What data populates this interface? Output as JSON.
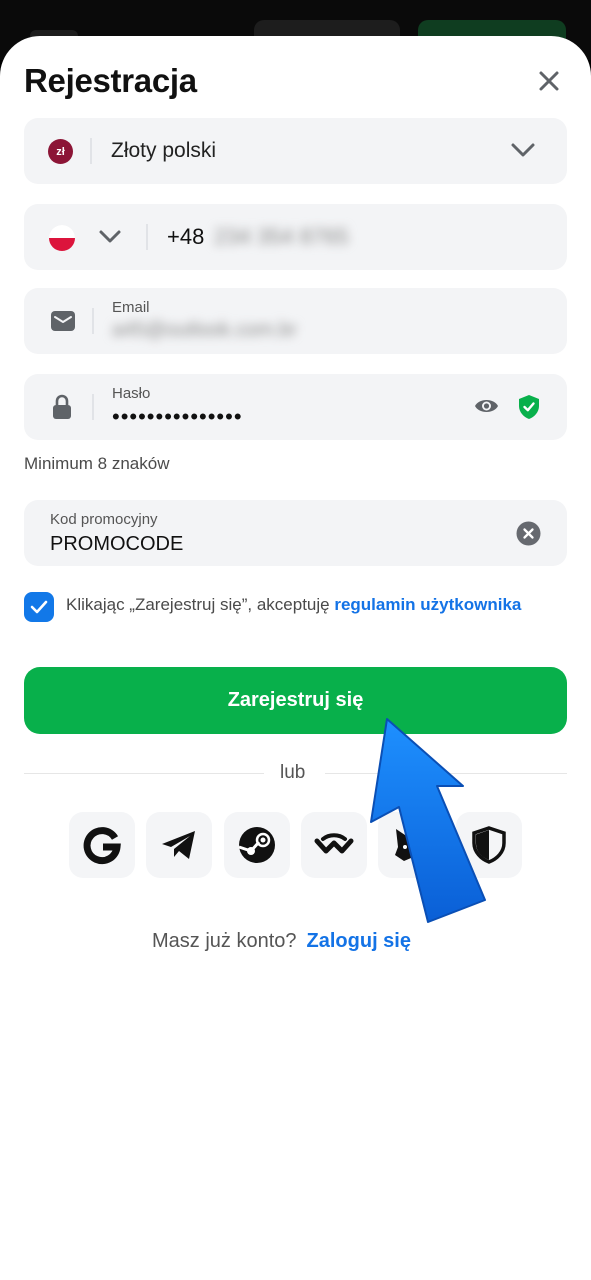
{
  "page": {
    "title": "Rejestracja"
  },
  "currency": {
    "badge": "zł",
    "value": "Złoty polski"
  },
  "phone": {
    "country_code": "+48",
    "number": "234 354 8765"
  },
  "email": {
    "label": "Email",
    "value": "a45@outlook.com.br"
  },
  "password": {
    "label": "Hasło",
    "value": "•••••••••••••••",
    "hint": "Minimum 8 znaków"
  },
  "promo": {
    "label": "Kod promocyjny",
    "value": "PROMOCODE"
  },
  "terms": {
    "checked": true,
    "text_before": "Klikając „Zarejestruj się”, akceptuję ",
    "link": "regulamin użytkownika"
  },
  "register_button": "Zarejestruj się",
  "or_text": "lub",
  "social": [
    {
      "name": "google",
      "icon": "google-icon"
    },
    {
      "name": "telegram",
      "icon": "telegram-icon"
    },
    {
      "name": "steam",
      "icon": "steam-icon"
    },
    {
      "name": "walletconnect",
      "icon": "walletconnect-icon"
    },
    {
      "name": "metamask",
      "icon": "metamask-icon"
    },
    {
      "name": "shield",
      "icon": "shield-icon"
    }
  ],
  "login": {
    "question": "Masz już konto?",
    "link": "Zaloguj się"
  },
  "colors": {
    "primary_green": "#08b04b",
    "link_blue": "#1473e6",
    "checkbox_blue": "#1278e8",
    "field_bg": "#f3f4f6"
  }
}
